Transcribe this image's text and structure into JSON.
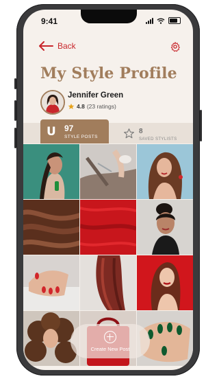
{
  "status_bar": {
    "time": "9:41"
  },
  "nav": {
    "back_label": "Back"
  },
  "page_title": "My Style Profile",
  "profile": {
    "name": "Jennifer Green",
    "rating": "4.8",
    "ratings_count": "(23 ratings)"
  },
  "stats": [
    {
      "badge": "U",
      "value": "97",
      "label": "STYLE POSTS",
      "active": true
    },
    {
      "value": "8",
      "label": "SAVED STYLISTS",
      "active": false
    }
  ],
  "posts": [
    {
      "subject": "braided-hair-woman"
    },
    {
      "subject": "stylist-cutting-hair"
    },
    {
      "subject": "wavy-brunette-woman"
    },
    {
      "subject": "brown-hair-closeup"
    },
    {
      "subject": "red-hair-closeup"
    },
    {
      "subject": "updo-woman"
    },
    {
      "subject": "red-manicure"
    },
    {
      "subject": "auburn-hair"
    },
    {
      "subject": "red-lipstick-woman"
    },
    {
      "subject": "curly-hair-woman"
    },
    {
      "subject": "red-bag"
    },
    {
      "subject": "green-manicure"
    }
  ],
  "fab": {
    "label": "Create New Post"
  },
  "colors": {
    "accent": "#c8262b",
    "brand_brown": "#a17d5c",
    "background": "#f6f1ec"
  }
}
